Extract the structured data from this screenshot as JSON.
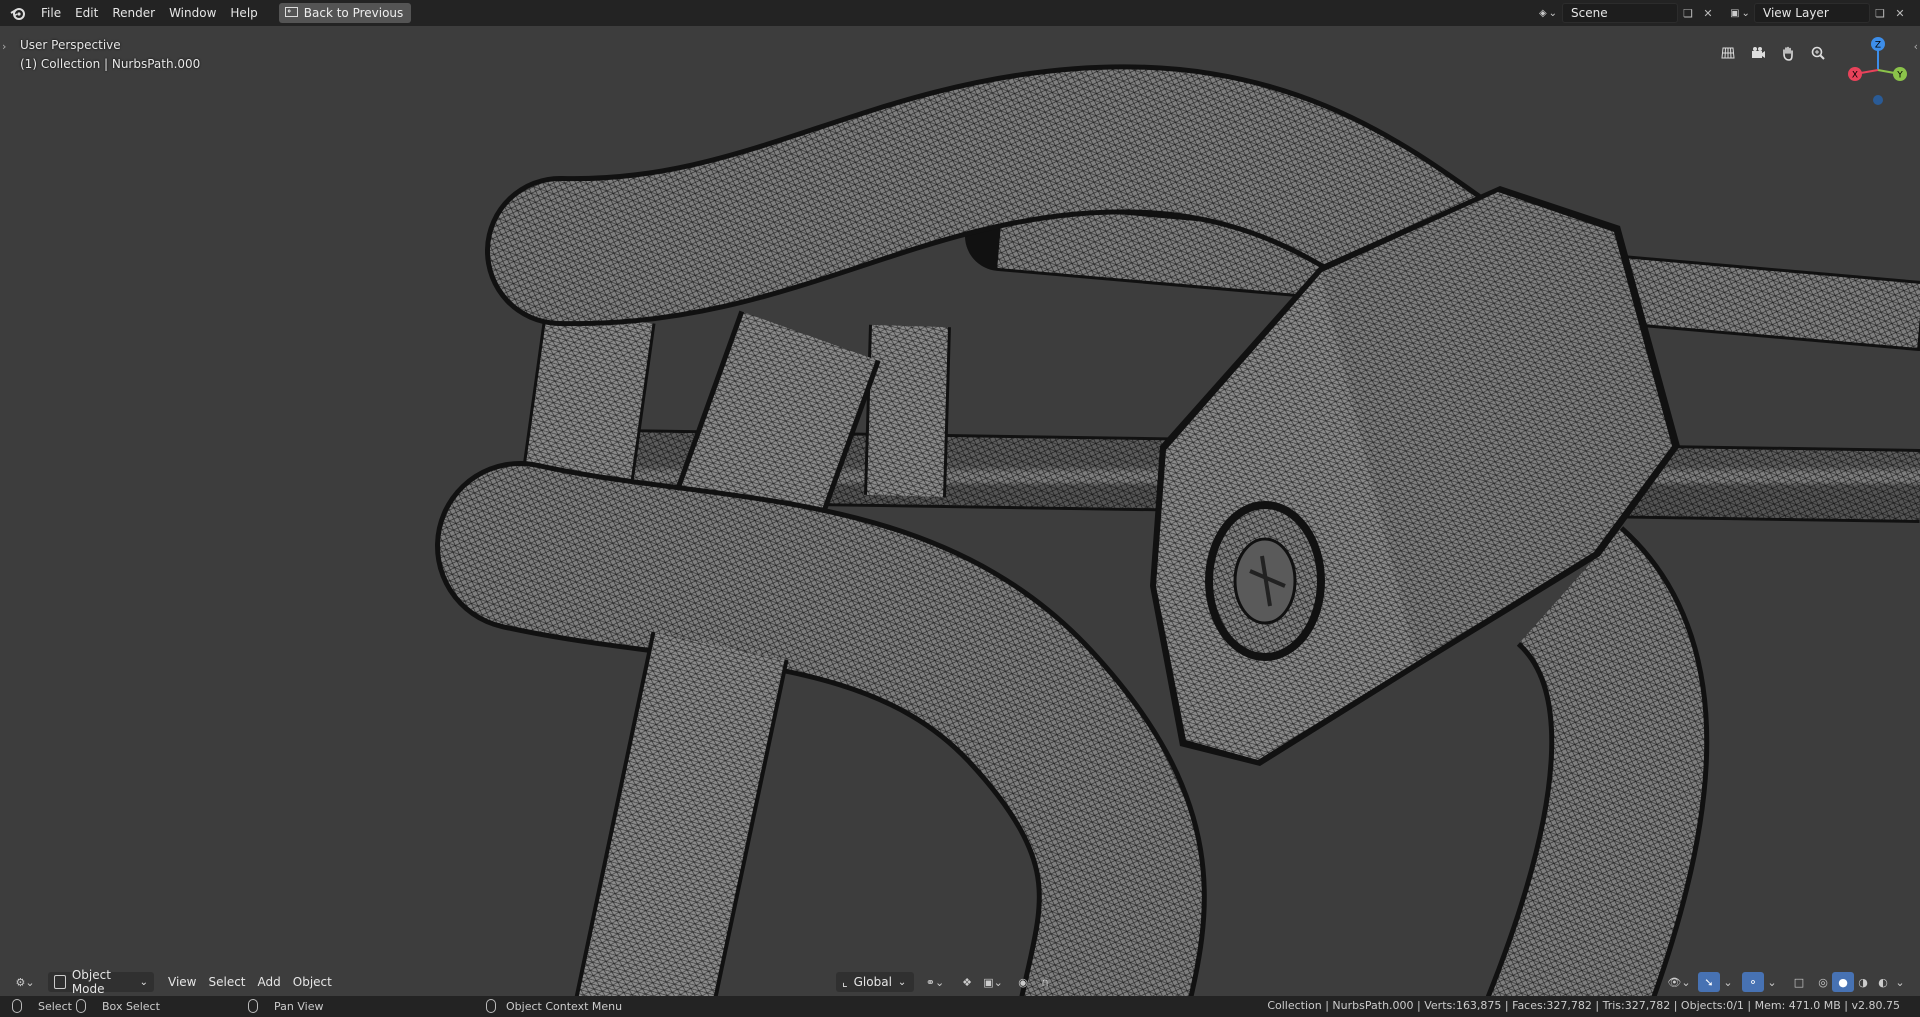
{
  "menu": {
    "items": [
      "File",
      "Edit",
      "Render",
      "Window",
      "Help"
    ],
    "back_label": "Back to Previous"
  },
  "top_right": {
    "scene": "Scene",
    "view_layer": "View Layer"
  },
  "viewport": {
    "perspective": "User Perspective",
    "collection": "(1) Collection | NurbsPath.000",
    "gizmo": {
      "x": "X",
      "y": "Y",
      "z": "Z"
    },
    "shading": "wireframe mesh"
  },
  "header": {
    "mode": "Object Mode",
    "menus": [
      "View",
      "Select",
      "Add",
      "Object"
    ],
    "orientation": "Global"
  },
  "status": {
    "select": "Select",
    "box_select": "Box Select",
    "pan_view": "Pan View",
    "context_menu": "Object Context Menu",
    "stats": "Collection | NurbsPath.000 | Verts:163,875 | Faces:327,782 | Tris:327,782 | Objects:0/1 | Mem: 471.0 MB | v2.80.75"
  },
  "colors": {
    "background": "#3d3d3d",
    "topbar": "#232323",
    "accent": "#4772b3",
    "axis_x": "#e8425a",
    "axis_y": "#8bc34a",
    "axis_z": "#3d8eea"
  }
}
